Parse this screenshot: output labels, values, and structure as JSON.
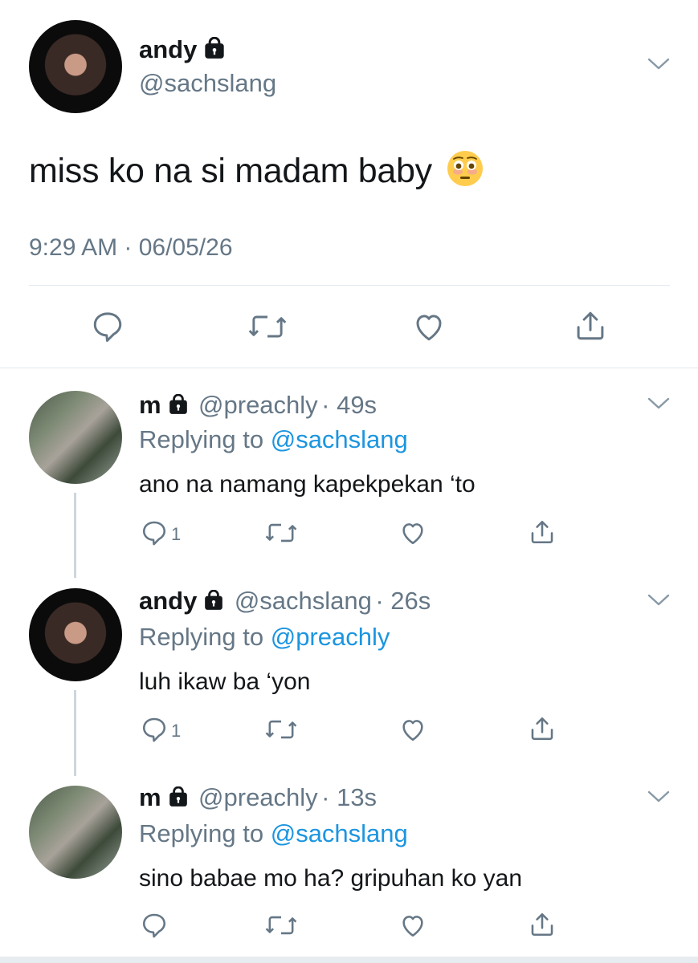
{
  "main_tweet": {
    "name": "andy",
    "handle": "@sachslang",
    "text": "miss ko na si madam baby",
    "emoji": "😳",
    "timestamp": "9:29 AM · 06/05/26"
  },
  "replies": [
    {
      "name": "m",
      "handle": "@preachly",
      "time": "· 49s",
      "replying_prefix": "Replying to ",
      "replying_to": "@sachslang",
      "text": "ano na namang kapekpekan ‘to",
      "reply_count": "1"
    },
    {
      "name": "andy",
      "handle": "@sachslang",
      "time": "· 26s",
      "replying_prefix": "Replying to ",
      "replying_to": "@preachly",
      "text": "luh ikaw ba ‘yon",
      "reply_count": "1"
    },
    {
      "name": "m",
      "handle": "@preachly",
      "time": "· 13s",
      "replying_prefix": "Replying to ",
      "replying_to": "@sachslang",
      "text": "sino babae mo ha? gripuhan ko yan",
      "reply_count": ""
    }
  ],
  "colors": {
    "link": "#1b95e0",
    "secondary_text": "#657786",
    "divider": "#e1e8ed"
  },
  "icons": [
    "lock-icon",
    "chevron-down-icon",
    "reply-icon",
    "retweet-icon",
    "like-icon",
    "share-icon"
  ]
}
